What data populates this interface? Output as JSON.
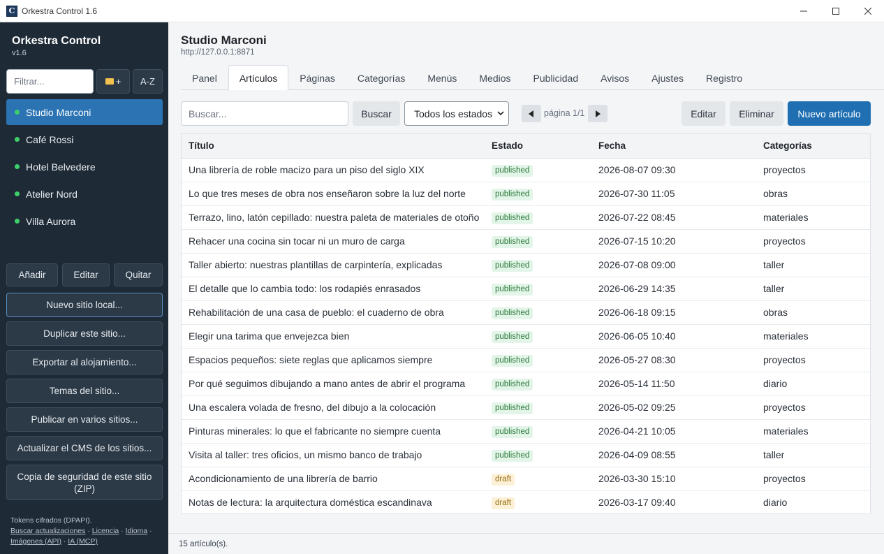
{
  "window": {
    "title": "Orkestra Control 1.6",
    "app_icon_letter": "C"
  },
  "sidebar": {
    "title": "Orkestra Control",
    "version": "v1.6",
    "filter_placeholder": "Filtrar...",
    "new_folder_label": "+",
    "sort_label": "A-Z",
    "sites": [
      {
        "label": "Studio Marconi",
        "active": true
      },
      {
        "label": "Café Rossi",
        "active": false
      },
      {
        "label": "Hotel Belvedere",
        "active": false
      },
      {
        "label": "Atelier Nord",
        "active": false
      },
      {
        "label": "Villa Aurora",
        "active": false
      }
    ],
    "add_label": "Añadir",
    "edit_label": "Editar",
    "remove_label": "Quitar",
    "actions": [
      "Nuevo sitio local...",
      "Duplicar este sitio...",
      "Exportar al alojamiento...",
      "Temas del sitio...",
      "Publicar en varios sitios...",
      "Actualizar el CMS de los sitios...",
      "Copia de seguridad de este sitio (ZIP)"
    ],
    "footer": {
      "tokens": "Tokens cifrados (DPAPI).",
      "links": [
        "Buscar actualizaciones",
        "Licencia",
        "Idioma",
        "Imágenes (API)",
        "IA (MCP)"
      ]
    }
  },
  "main": {
    "site_name": "Studio Marconi",
    "site_url": "http://127.0.0.1:8871",
    "tabs": [
      "Panel",
      "Artículos",
      "Páginas",
      "Categorías",
      "Menús",
      "Medios",
      "Publicidad",
      "Avisos",
      "Ajustes",
      "Registro"
    ],
    "active_tab": "Artículos",
    "toolbar": {
      "search_placeholder": "Buscar...",
      "search_button": "Buscar",
      "status_filter": "Todos los estados",
      "page_label": "página 1/1",
      "edit_button": "Editar",
      "delete_button": "Eliminar",
      "new_button": "Nuevo artículo"
    },
    "table": {
      "columns": [
        "Título",
        "Estado",
        "Fecha",
        "Categorías"
      ],
      "rows": [
        {
          "title": "Una librería de roble macizo para un piso del siglo XIX",
          "status": "published",
          "date": "2026-08-07 09:30",
          "category": "proyectos"
        },
        {
          "title": "Lo que tres meses de obra nos enseñaron sobre la luz del norte",
          "status": "published",
          "date": "2026-07-30 11:05",
          "category": "obras"
        },
        {
          "title": "Terrazo, lino, latón cepillado: nuestra paleta de materiales de otoño",
          "status": "published",
          "date": "2026-07-22 08:45",
          "category": "materiales"
        },
        {
          "title": "Rehacer una cocina sin tocar ni un muro de carga",
          "status": "published",
          "date": "2026-07-15 10:20",
          "category": "proyectos"
        },
        {
          "title": "Taller abierto: nuestras plantillas de carpintería, explicadas",
          "status": "published",
          "date": "2026-07-08 09:00",
          "category": "taller"
        },
        {
          "title": "El detalle que lo cambia todo: los rodapiés enrasados",
          "status": "published",
          "date": "2026-06-29 14:35",
          "category": "taller"
        },
        {
          "title": "Rehabilitación de una casa de pueblo: el cuaderno de obra",
          "status": "published",
          "date": "2026-06-18 09:15",
          "category": "obras"
        },
        {
          "title": "Elegir una tarima que envejezca bien",
          "status": "published",
          "date": "2026-06-05 10:40",
          "category": "materiales"
        },
        {
          "title": "Espacios pequeños: siete reglas que aplicamos siempre",
          "status": "published",
          "date": "2026-05-27 08:30",
          "category": "proyectos"
        },
        {
          "title": "Por qué seguimos dibujando a mano antes de abrir el programa",
          "status": "published",
          "date": "2026-05-14 11:50",
          "category": "diario"
        },
        {
          "title": "Una escalera volada de fresno, del dibujo a la colocación",
          "status": "published",
          "date": "2026-05-02 09:25",
          "category": "proyectos"
        },
        {
          "title": "Pinturas minerales: lo que el fabricante no siempre cuenta",
          "status": "published",
          "date": "2026-04-21 10:05",
          "category": "materiales"
        },
        {
          "title": "Visita al taller: tres oficios, un mismo banco de trabajo",
          "status": "published",
          "date": "2026-04-09 08:55",
          "category": "taller"
        },
        {
          "title": "Acondicionamiento de una librería de barrio",
          "status": "draft",
          "date": "2026-03-30 15:10",
          "category": "proyectos"
        },
        {
          "title": "Notas de lectura: la arquitectura doméstica escandinava",
          "status": "draft",
          "date": "2026-03-17 09:40",
          "category": "diario"
        }
      ]
    },
    "status_bar": "15 artículo(s)."
  },
  "colors": {
    "sidebar_bg": "#1e2a36",
    "accent": "#1f6fb2",
    "active_site": "#2b73b3",
    "online_dot": "#3ccf6a",
    "published_badge": "#e3f5e8",
    "draft_badge": "#fcf1d6"
  }
}
